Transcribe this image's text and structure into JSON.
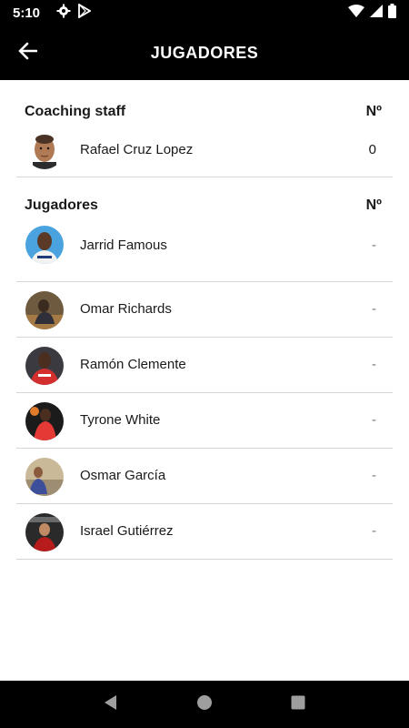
{
  "status_bar": {
    "time": "5:10",
    "icons_left": [
      "gear-icon",
      "play-store-icon"
    ],
    "icons_right": [
      "wifi-icon",
      "cell-signal-icon",
      "battery-icon"
    ]
  },
  "app_bar": {
    "title": "JUGADORES",
    "back_icon": "arrow-left-icon"
  },
  "coaching_staff": {
    "title": "Coaching staff",
    "number_header": "Nº",
    "members": [
      {
        "name": "Rafael Cruz Lopez",
        "number": "0"
      }
    ]
  },
  "players": {
    "title": "Jugadores",
    "number_header": "Nº",
    "members": [
      {
        "name": "Jarrid Famous",
        "number": "-"
      },
      {
        "name": "Omar Richards",
        "number": "-"
      },
      {
        "name": "Ramón Clemente",
        "number": "-"
      },
      {
        "name": "Tyrone White",
        "number": "-"
      },
      {
        "name": "Osmar García",
        "number": "-"
      },
      {
        "name": "Israel Gutiérrez",
        "number": "-"
      }
    ]
  },
  "nav_bar": {
    "buttons": [
      "back-triangle-icon",
      "home-circle-icon",
      "recents-square-icon"
    ]
  },
  "colors": {
    "bars": "#000000",
    "divider": "#d6d6d6",
    "text": "#1a1a1a"
  }
}
